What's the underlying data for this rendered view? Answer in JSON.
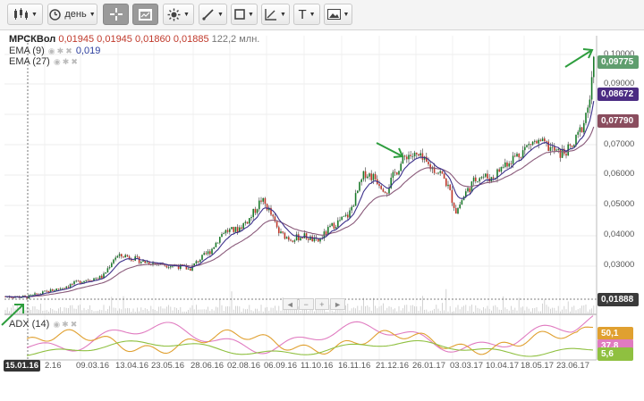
{
  "toolbar": {
    "period_label": "день",
    "text_tool": "T"
  },
  "legend": {
    "symbol": "МРСКВол",
    "open": "0,01945",
    "high": "0,01945",
    "low": "0,01860",
    "close": "0,01885",
    "volume": "122,2 млн.",
    "ema9_label": "EMA (9)",
    "ema9_value": "0,019",
    "ema27_label": "EMA (27)",
    "adx_label": "ADX (14)"
  },
  "price_axis": [
    "0,10000",
    "0,09000",
    "0,07000",
    "0,06000",
    "0,05000",
    "0,04000",
    "0,03000"
  ],
  "price_tags": {
    "last": "0,09775",
    "ema9": "0,08672",
    "ema27": "0,07790",
    "cursor": "0,01888"
  },
  "adx_tags": {
    "di_plus": "50,1",
    "di_minus": "37,8",
    "adx": "5,6"
  },
  "time_axis": {
    "cursor": "15.01.16",
    "labels": [
      "2.16",
      "09.03.16",
      "13.04.16",
      "23.05.16",
      "28.06.16",
      "02.08.16",
      "06.09.16",
      "11.10.16",
      "16.11.16",
      "21.12.16",
      "26.01.17",
      "03.03.17",
      "10.04.17",
      "18.05.17",
      "23.06.17"
    ]
  },
  "scroller": {
    "left": "◄",
    "minus": "−",
    "plus": "+",
    "right": "►"
  },
  "colors": {
    "price_tag_last": "#5f9e6e",
    "price_tag_ema9": "#4b2b82",
    "price_tag_ema27": "#8a4d5e",
    "price_tag_cursor": "#3a3a3a",
    "adx_plus": "#e0a030",
    "adx_minus": "#e07bc0",
    "adx_line": "#8fc040",
    "arrow": "#2e9e3e"
  }
}
